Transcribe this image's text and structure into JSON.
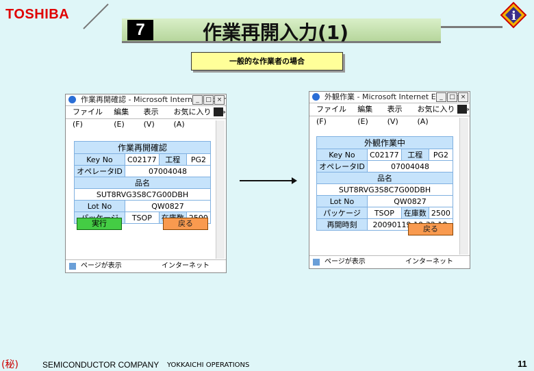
{
  "header": {
    "logo": "TOSHIBA",
    "slide_number": "7",
    "title": "作業再開入力(1)",
    "subtitle": "一般的な作業者の場合"
  },
  "left_window": {
    "title": "作業再開確認 - Microsoft Internet Explorer",
    "menu": [
      "ファイル(F)",
      "編集(E)",
      "表示(V)",
      "お気に入り(A)"
    ],
    "menu_more": "»",
    "table_title": "作業再開確認",
    "keyno_label": "Key No",
    "keyno_value": "C02177",
    "process_label": "工程",
    "process_value": "PG2",
    "operator_label": "オペレータID",
    "operator_value": "07004048",
    "product_label": "品名",
    "product_value": "SUT8RVG3S8C7G00DBH",
    "lot_label": "Lot No",
    "lot_value": "QW0827",
    "package_label": "パッケージ",
    "package_value": "TSOP",
    "stock_label": "在庫数",
    "stock_value": "2500",
    "execute_button": "実行",
    "back_button": "戻る",
    "status_left": "ページが表示",
    "status_right": "インターネット"
  },
  "right_window": {
    "title": "外観作業 - Microsoft Internet Explorer",
    "menu": [
      "ファイル(F)",
      "編集(E)",
      "表示(V)",
      "お気に入り(A)"
    ],
    "menu_more": "»",
    "table_title": "外観作業中",
    "keyno_label": "Key No",
    "keyno_value": "C02177",
    "process_label": "工程",
    "process_value": "PG2",
    "operator_label": "オペレータID",
    "operator_value": "07004048",
    "product_label": "品名",
    "product_value": "SUT8RVG3S8C7G00DBH",
    "lot_label": "Lot No",
    "lot_value": "QW0827",
    "package_label": "パッケージ",
    "package_value": "TSOP",
    "stock_label": "在庫数",
    "stock_value": "2500",
    "restart_label": "再開時刻",
    "restart_value": "20090119 10:32:10",
    "back_button": "戻る",
    "status_left": "ページが表示",
    "status_right": "インターネット"
  },
  "footer": {
    "mark": "(秘)",
    "company": "SEMICONDUCTOR COMPANY",
    "operations": "YOKKAICHI OPERATIONS",
    "page": "11"
  },
  "colors": {
    "background": "#dff6f8",
    "logo_red": "#e00000",
    "title_green": "#b6d69c",
    "subtitle_yellow": "#ffff99",
    "table_header_blue": "#c6e3fb",
    "execute_green": "#44cc44",
    "back_orange": "#f99a4f"
  }
}
